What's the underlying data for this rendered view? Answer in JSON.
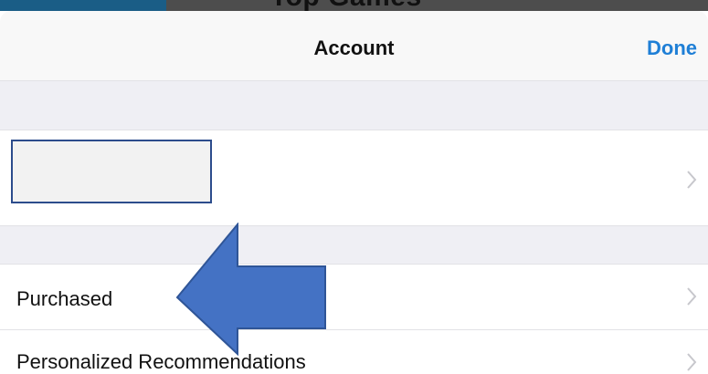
{
  "background": {
    "title_fragment": "Top Games"
  },
  "navbar": {
    "title": "Account",
    "done_label": "Done",
    "accent_color": "#1f7fd6"
  },
  "account_row": {
    "chevron_icon": "chevron-right-icon"
  },
  "rows": [
    {
      "label": "Purchased",
      "chevron_icon": "chevron-right-icon"
    },
    {
      "label": "Personalized Recommendations",
      "chevron_icon": "chevron-right-icon"
    }
  ],
  "annotation": {
    "arrow_color": "#4472c4",
    "arrow_direction": "left"
  }
}
